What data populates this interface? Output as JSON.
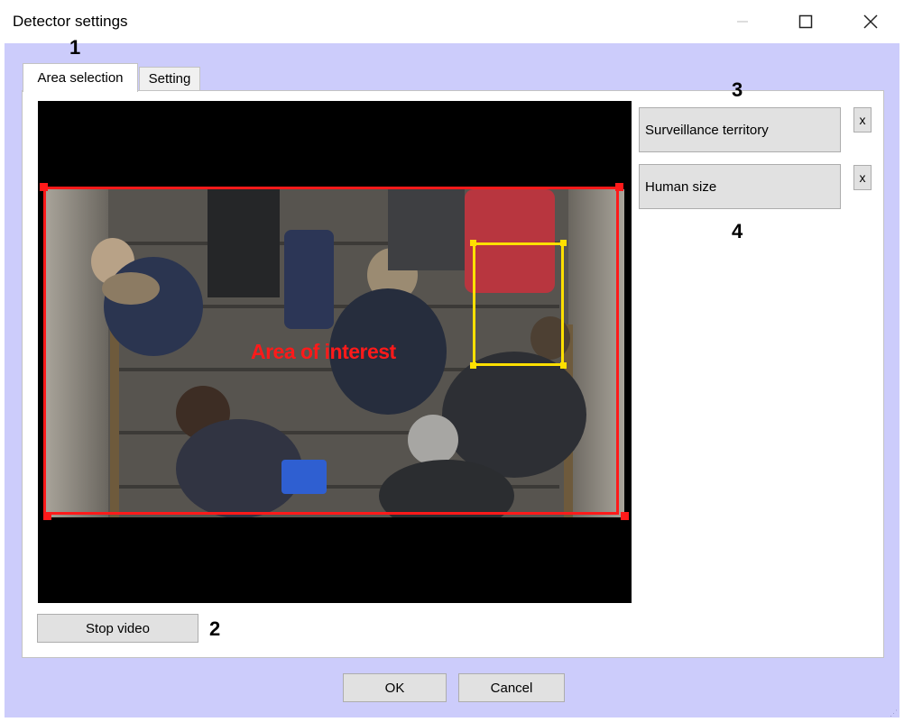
{
  "window": {
    "title": "Detector settings"
  },
  "markers": {
    "m1": "1",
    "m2": "2",
    "m3": "3",
    "m4": "4"
  },
  "tabs": [
    {
      "label": "Area selection",
      "active": true
    },
    {
      "label": "Setting",
      "active": false
    }
  ],
  "video": {
    "roi_label": "Area of interest"
  },
  "controls": {
    "stop_video": "Stop video",
    "surveillance_territory": "Surveillance territory",
    "human_size": "Human size",
    "remove": "x"
  },
  "footer": {
    "ok": "OK",
    "cancel": "Cancel"
  },
  "colors": {
    "roi": "#ff1a1a",
    "human_box": "#ffe000",
    "client_bg": "#ccccfb"
  }
}
